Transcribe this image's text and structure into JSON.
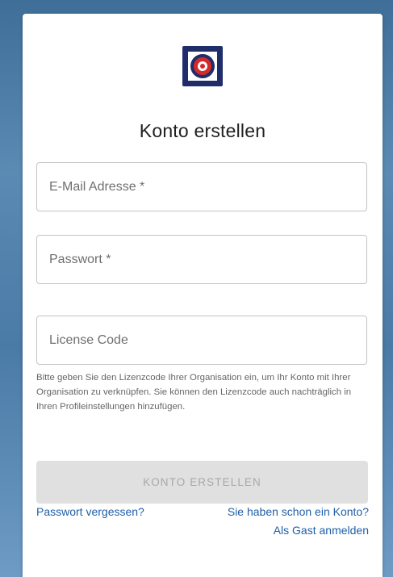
{
  "title": "Konto erstellen",
  "fields": {
    "email": {
      "placeholder": "E-Mail Adresse *"
    },
    "password": {
      "placeholder": "Passwort *"
    },
    "license": {
      "placeholder": "License Code"
    }
  },
  "helper_text": "Bitte geben Sie den Lizenzcode Ihrer Organisation ein, um Ihr Konto mit Ihrer Organisation zu verknüpfen. Sie können den Lizenzcode auch nachträglich in Ihren Profileinstellungen hinzufügen.",
  "submit_label": "KONTO ERSTELLEN",
  "links": {
    "forgot": "Passwort vergessen?",
    "login": "Sie haben schon ein Konto?",
    "guest": "Als Gast anmelden"
  },
  "colors": {
    "logo_navy": "#1f2d6b",
    "logo_red": "#d42a2a",
    "link": "#1f5fa8"
  }
}
